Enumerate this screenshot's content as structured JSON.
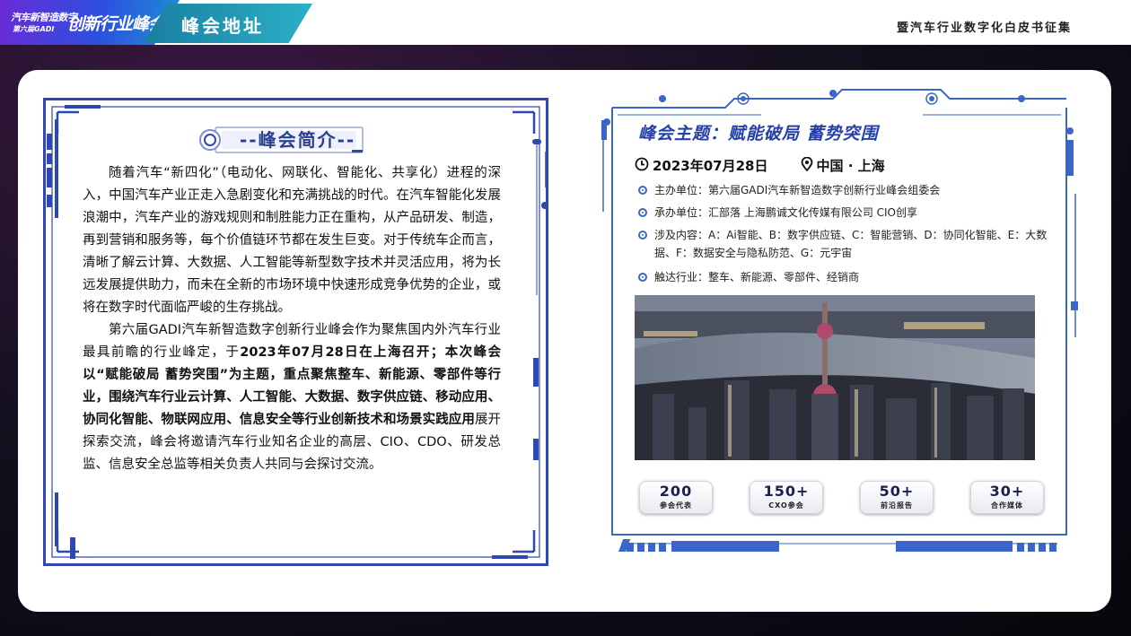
{
  "header": {
    "logo_line1": "汽车新智造数字",
    "logo_line2": "第六届GADI",
    "logo_big": "创新行业峰会",
    "section_title": "峰会地址",
    "right_title": "暨汽车行业数字化白皮书征集"
  },
  "intro": {
    "title": "--峰会简介--",
    "paragraph1": "随着汽车“新四化”（电动化、网联化、智能化、共享化）进程的深入，中国汽车产业正走入急剧变化和充满挑战的时代。在汽车智能化发展浪潮中，汽车产业的游戏规则和制胜能力正在重构，从产品研发、制造，再到营销和服务等，每个价值链环节都在发生巨变。对于传统车企而言，清晰了解云计算、大数据、人工智能等新型数字技术并灵活应用，将为长远发展提供助力，而未在全新的市场环境中快速形成竞争优势的企业，或将在数字时代面临严峻的生存挑战。",
    "p2_part1": "第六届GADI汽车新智造数字创新行业峰会作为聚焦国内外汽车行业最具前瞻的行业峰定，于",
    "p2_bold": "2023年07月28日在上海召开；本次峰会以“赋能破局 蓄势突围”为主题，重点聚焦整车、新能源、零部件等行业，围绕汽车行业云计算、人工智能、大数据、数字供应链、移动应用、协同化智能、物联网应用、信息安全等行业创新技术和场景实践应用",
    "p2_part2": "展开探索交流，峰会将邀请汽车行业知名企业的高层、CIO、CDO、研发总监、信息安全总监等相关负责人共同与会探讨交流。"
  },
  "summit": {
    "theme": "峰会主题：赋能破局 蓄势突围",
    "date": "2023年07月28日",
    "location": "中国 · 上海",
    "items": [
      {
        "text": "主办单位：第六届GADI汽车新智造数字创新行业峰会组委会"
      },
      {
        "text": "承办单位：汇部落 上海鹏诚文化传媒有限公司  CIO创享"
      },
      {
        "text": "涉及内容：A：Ai智能、B：数字供应链、C：智能营销、D：协同化智能、E：大数据、F：数据安全与隐私防范、G：元宇宙"
      },
      {
        "text": "触达行业：整车、新能源、零部件、经销商"
      }
    ],
    "stats": [
      {
        "num": "200",
        "label": "参会代表"
      },
      {
        "num": "150+",
        "label": "CXO参会"
      },
      {
        "num": "50+",
        "label": "前沿报告"
      },
      {
        "num": "30+",
        "label": "合作媒体"
      }
    ]
  },
  "colors": {
    "frame_blue": "#2f47b0",
    "accent_blue": "#3b66c9",
    "theme_blue": "#2540a8"
  }
}
